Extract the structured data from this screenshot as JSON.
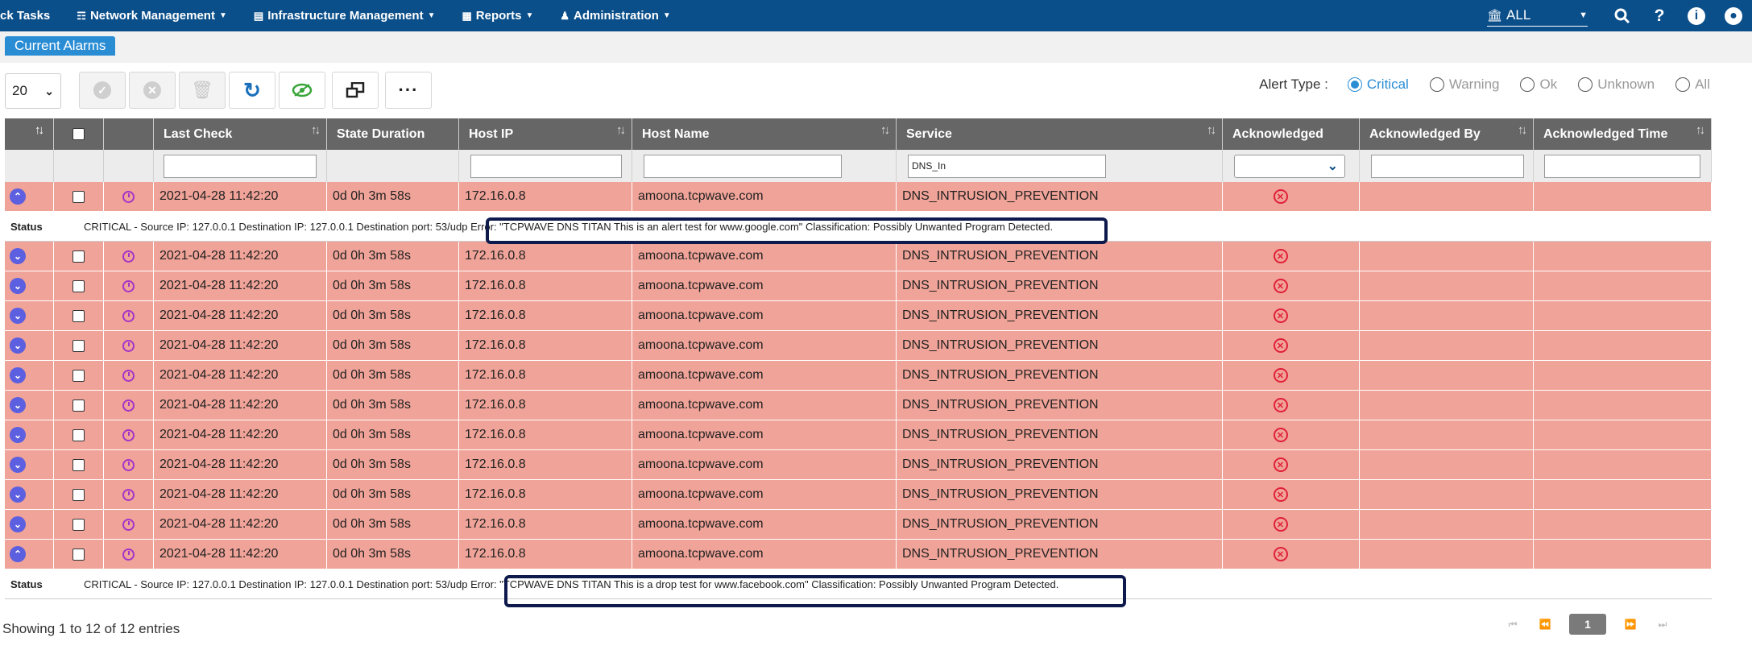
{
  "nav": {
    "items": [
      {
        "label": "ck Tasks",
        "icon": ""
      },
      {
        "label": "Network Management",
        "icon": "sitemap-icon"
      },
      {
        "label": "Infrastructure Management",
        "icon": "server-icon"
      },
      {
        "label": "Reports",
        "icon": "book-icon"
      },
      {
        "label": "Administration",
        "icon": "users-icon"
      }
    ],
    "scope_value": "ALL"
  },
  "tab": {
    "label": "Current Alarms"
  },
  "toolbar": {
    "page_size": "20"
  },
  "alert_type": {
    "label": "Alert Type :",
    "options": [
      "Critical",
      "Warning",
      "Ok",
      "Unknown",
      "All"
    ],
    "selected": "Critical"
  },
  "table": {
    "columns": [
      "",
      "",
      "",
      "Last Check",
      "State Duration",
      "Host IP",
      "Host Name",
      "Service",
      "Acknowledged",
      "Acknowledged By",
      "Acknowledged Time"
    ],
    "filters": {
      "service": "DNS_In"
    },
    "rows": [
      {
        "last_check": "2021-04-28 11:42:20",
        "duration": "0d 0h 3m 58s",
        "ip": "172.16.0.8",
        "host": "amoona.tcpwave.com",
        "service": "DNS_INTRUSION_PREVENTION",
        "expanded": true
      },
      {
        "last_check": "2021-04-28 11:42:20",
        "duration": "0d 0h 3m 58s",
        "ip": "172.16.0.8",
        "host": "amoona.tcpwave.com",
        "service": "DNS_INTRUSION_PREVENTION",
        "expanded": false
      },
      {
        "last_check": "2021-04-28 11:42:20",
        "duration": "0d 0h 3m 58s",
        "ip": "172.16.0.8",
        "host": "amoona.tcpwave.com",
        "service": "DNS_INTRUSION_PREVENTION",
        "expanded": false
      },
      {
        "last_check": "2021-04-28 11:42:20",
        "duration": "0d 0h 3m 58s",
        "ip": "172.16.0.8",
        "host": "amoona.tcpwave.com",
        "service": "DNS_INTRUSION_PREVENTION",
        "expanded": false
      },
      {
        "last_check": "2021-04-28 11:42:20",
        "duration": "0d 0h 3m 58s",
        "ip": "172.16.0.8",
        "host": "amoona.tcpwave.com",
        "service": "DNS_INTRUSION_PREVENTION",
        "expanded": false
      },
      {
        "last_check": "2021-04-28 11:42:20",
        "duration": "0d 0h 3m 58s",
        "ip": "172.16.0.8",
        "host": "amoona.tcpwave.com",
        "service": "DNS_INTRUSION_PREVENTION",
        "expanded": false
      },
      {
        "last_check": "2021-04-28 11:42:20",
        "duration": "0d 0h 3m 58s",
        "ip": "172.16.0.8",
        "host": "amoona.tcpwave.com",
        "service": "DNS_INTRUSION_PREVENTION",
        "expanded": false
      },
      {
        "last_check": "2021-04-28 11:42:20",
        "duration": "0d 0h 3m 58s",
        "ip": "172.16.0.8",
        "host": "amoona.tcpwave.com",
        "service": "DNS_INTRUSION_PREVENTION",
        "expanded": false
      },
      {
        "last_check": "2021-04-28 11:42:20",
        "duration": "0d 0h 3m 58s",
        "ip": "172.16.0.8",
        "host": "amoona.tcpwave.com",
        "service": "DNS_INTRUSION_PREVENTION",
        "expanded": false
      },
      {
        "last_check": "2021-04-28 11:42:20",
        "duration": "0d 0h 3m 58s",
        "ip": "172.16.0.8",
        "host": "amoona.tcpwave.com",
        "service": "DNS_INTRUSION_PREVENTION",
        "expanded": false
      },
      {
        "last_check": "2021-04-28 11:42:20",
        "duration": "0d 0h 3m 58s",
        "ip": "172.16.0.8",
        "host": "amoona.tcpwave.com",
        "service": "DNS_INTRUSION_PREVENTION",
        "expanded": false
      },
      {
        "last_check": "2021-04-28 11:42:20",
        "duration": "0d 0h 3m 58s",
        "ip": "172.16.0.8",
        "host": "amoona.tcpwave.com",
        "service": "DNS_INTRUSION_PREVENTION",
        "expanded": true
      }
    ],
    "status_label": "Status",
    "status_1": "CRITICAL - Source IP: 127.0.0.1 Destination IP: 127.0.0.1 Destination port: 53/udp Error: \"TCPWAVE DNS TITAN This is an alert test for www.google.com\" Classification: Possibly Unwanted Program Detected.",
    "status_2": "CRITICAL - Source IP: 127.0.0.1 Destination IP: 127.0.0.1 Destination port: 53/udp Error: \"TCPWAVE DNS TITAN This is a drop test for www.facebook.com\" Classification: Possibly Unwanted Program Detected."
  },
  "footer": {
    "info": "Showing 1 to 12 of 12 entries",
    "current_page": "1"
  },
  "colors": {
    "nav": "#0b4f8a",
    "critical_row": "#f0a398",
    "header": "#666666",
    "accent": "#2a8dd4"
  }
}
